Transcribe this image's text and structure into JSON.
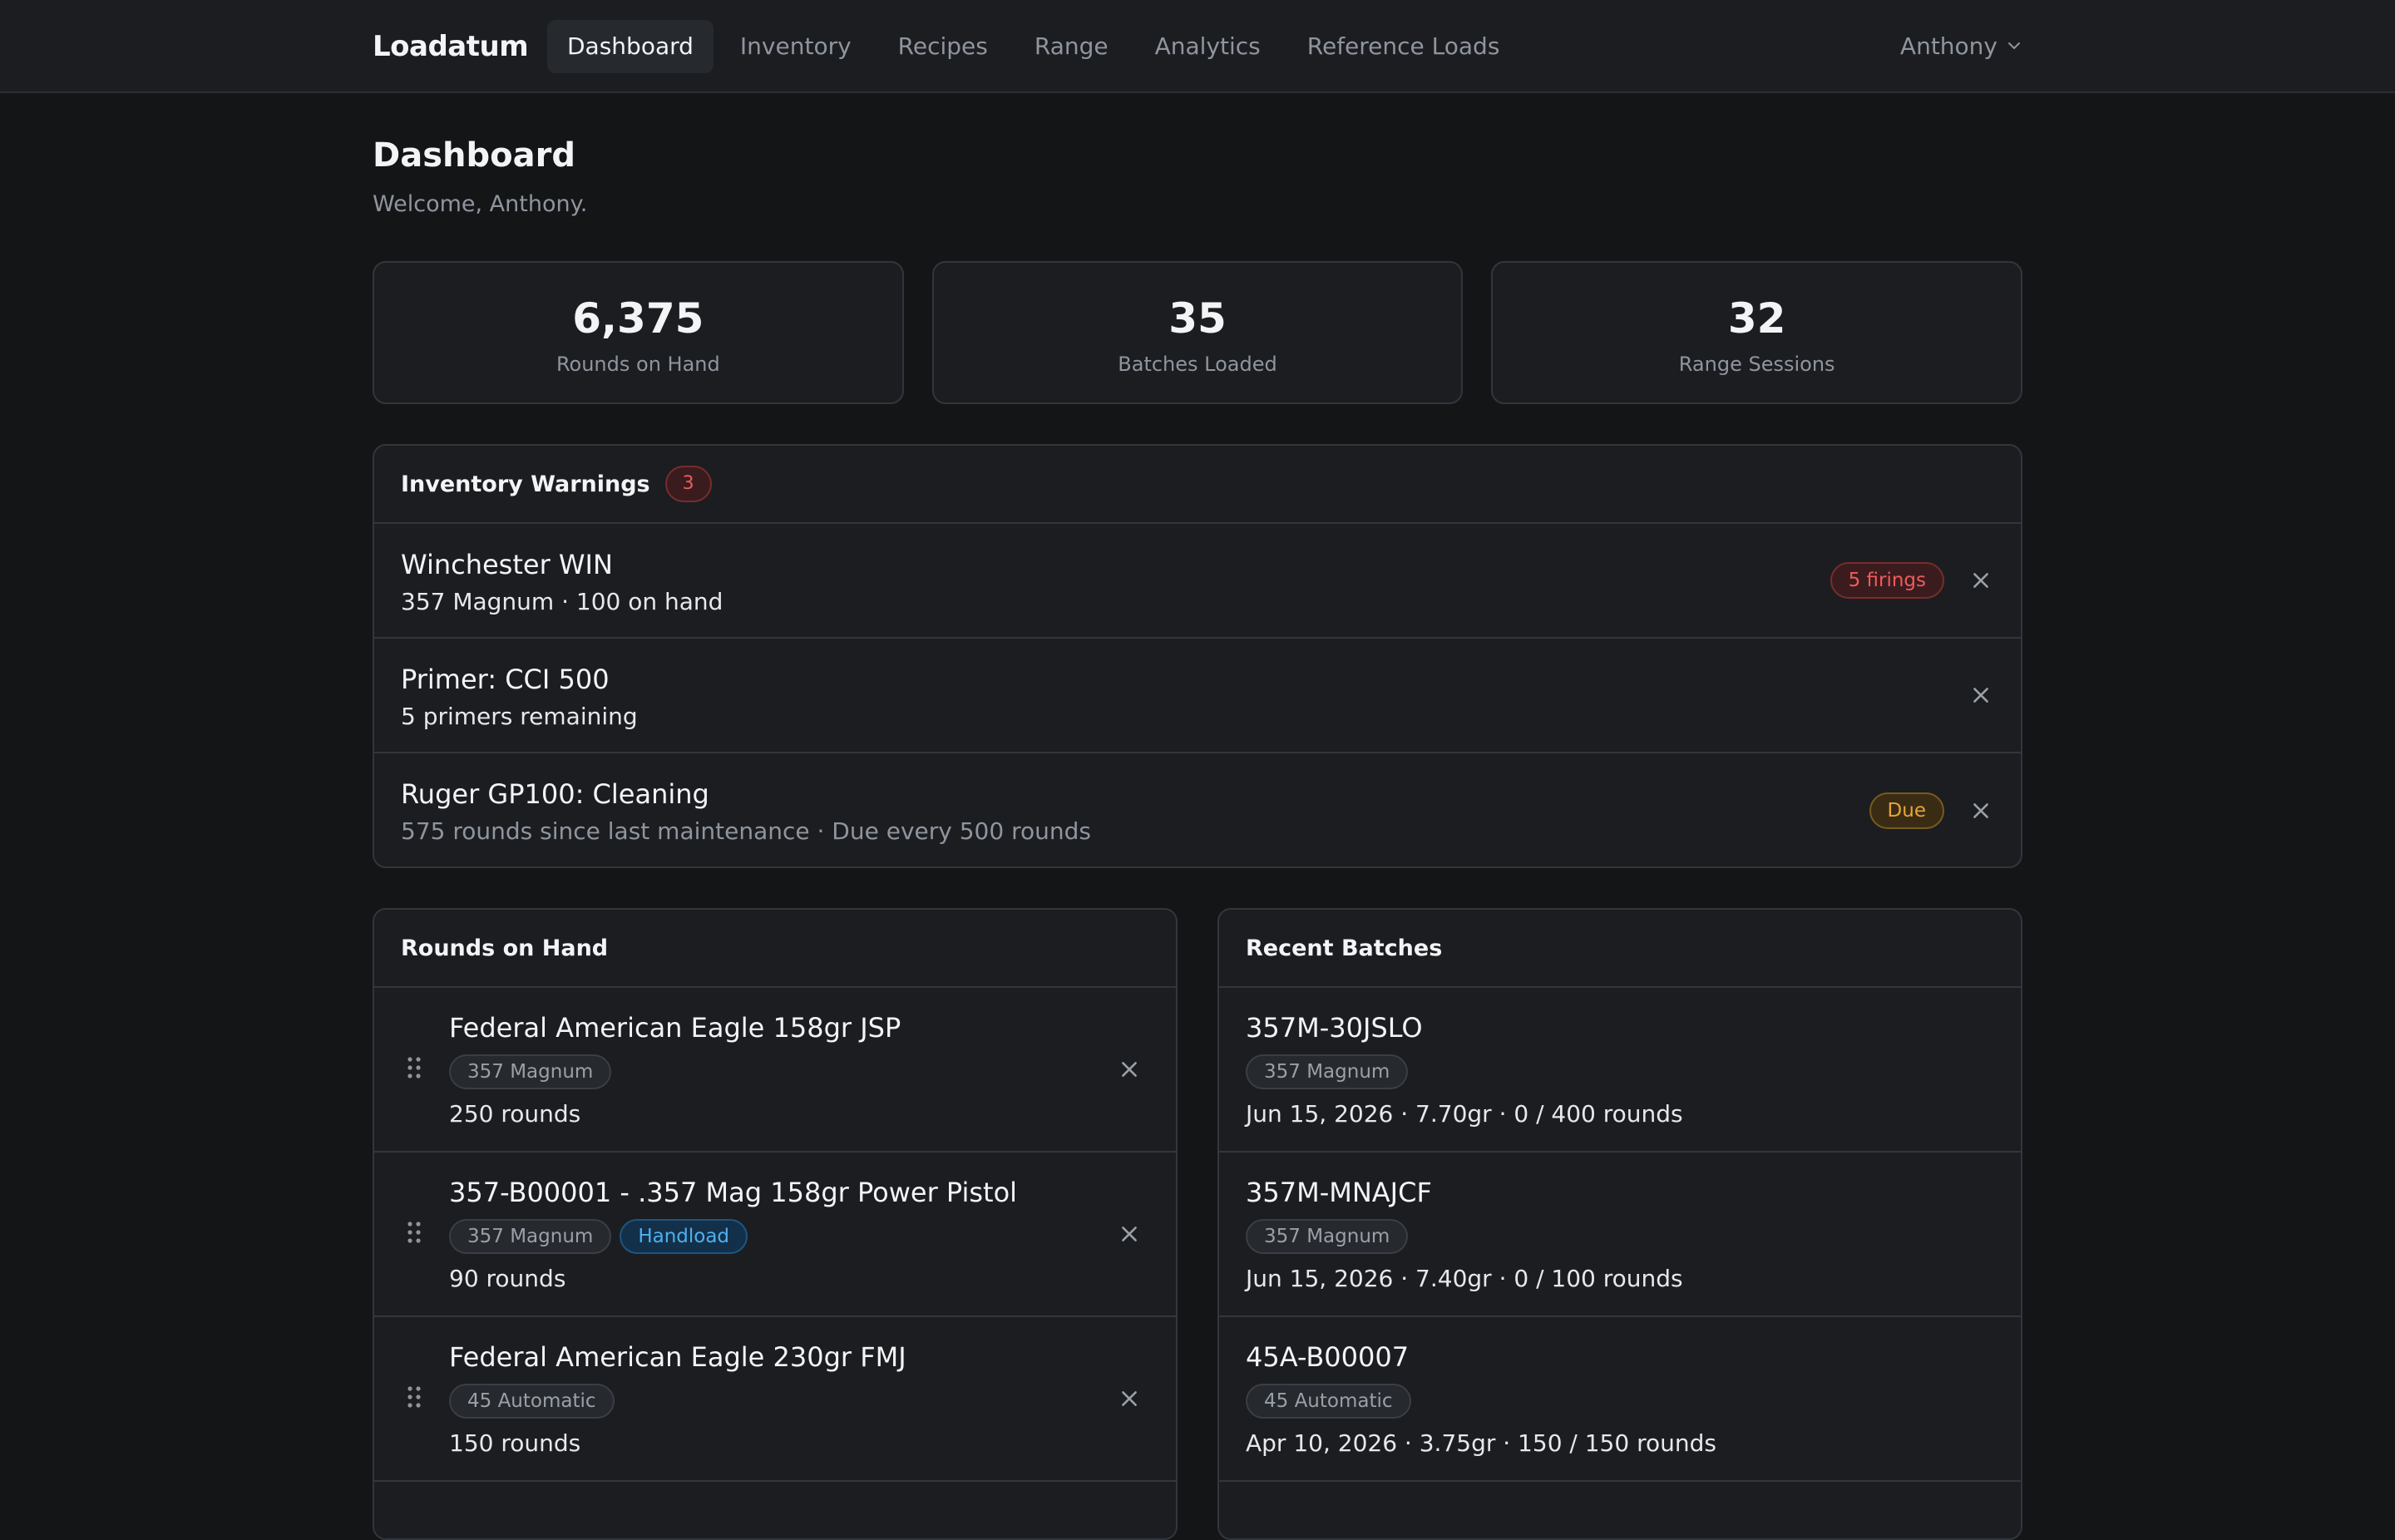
{
  "app": {
    "brand": "Loadatum"
  },
  "nav": {
    "items": [
      {
        "label": "Dashboard",
        "active": true
      },
      {
        "label": "Inventory"
      },
      {
        "label": "Recipes"
      },
      {
        "label": "Range"
      },
      {
        "label": "Analytics"
      },
      {
        "label": "Reference Loads"
      }
    ],
    "user": "Anthony"
  },
  "page": {
    "title": "Dashboard",
    "welcome": "Welcome, Anthony."
  },
  "stats": [
    {
      "value": "6,375",
      "label": "Rounds on Hand"
    },
    {
      "value": "35",
      "label": "Batches Loaded"
    },
    {
      "value": "32",
      "label": "Range Sessions"
    }
  ],
  "warnings": {
    "title": "Inventory Warnings",
    "count": "3",
    "items": [
      {
        "title": "Winchester WIN",
        "sub": "357 Magnum · 100 on hand",
        "badge": "5 firings"
      },
      {
        "title": "Primer: CCI 500",
        "sub": "5 primers remaining"
      },
      {
        "title": "Ruger GP100: Cleaning",
        "sub": "575 rounds since last maintenance · Due every 500 rounds",
        "badge": "Due"
      }
    ]
  },
  "rounds": {
    "title": "Rounds on Hand",
    "items": [
      {
        "title": "Federal American Eagle 158gr JSP",
        "caliber": "357 Magnum",
        "count": "250 rounds"
      },
      {
        "title": "357-B00001 - .357 Mag 158gr Power Pistol",
        "caliber": "357 Magnum",
        "extra_tag": "Handload",
        "count": "90 rounds"
      },
      {
        "title": "Federal American Eagle 230gr FMJ",
        "caliber": "45 Automatic",
        "count": "150 rounds"
      }
    ]
  },
  "batches": {
    "title": "Recent Batches",
    "items": [
      {
        "title": "357M-30JSLO",
        "caliber": "357 Magnum",
        "sub": "Jun 15, 2026 · 7.70gr · 0 / 400 rounds"
      },
      {
        "title": "357M-MNAJCF",
        "caliber": "357 Magnum",
        "sub": "Jun 15, 2026 · 7.40gr · 0 / 100 rounds"
      },
      {
        "title": "45A-B00007",
        "caliber": "45 Automatic",
        "sub": "Apr 10, 2026 · 3.75gr · 150 / 150 rounds"
      }
    ]
  },
  "colors": {
    "background": "#141517",
    "panel": "#1b1d20",
    "danger": "#ef5b5b",
    "warning": "#e5a53a",
    "info": "#4fb0f0"
  }
}
